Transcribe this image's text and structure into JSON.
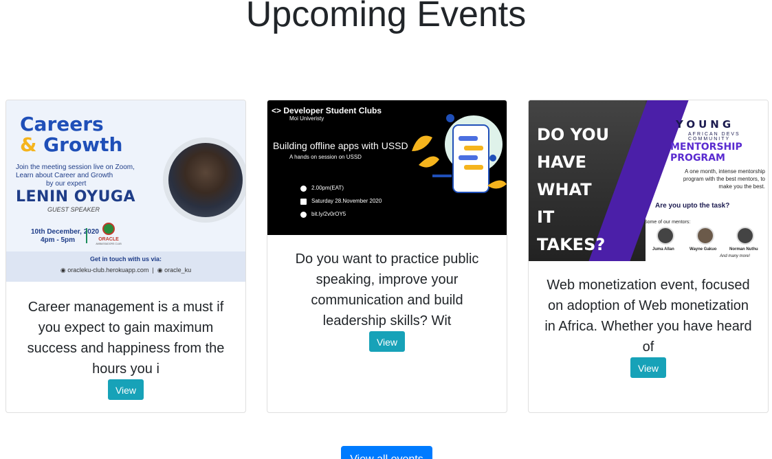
{
  "page": {
    "heading": "Upcoming Events",
    "view_all_label": "View all events"
  },
  "colors": {
    "view_button": "#17a2b8",
    "view_all_button": "#007bff"
  },
  "events": [
    {
      "description": "Career management is a must if you expect to gain maximum success and happiness from the hours you i",
      "button_label": "View",
      "poster": {
        "title_line1": "Careers",
        "title_amp": "&",
        "title_line2": "Growth",
        "sub1": "Join the meeting session live on Zoom,",
        "sub2": "Learn about Career and Growth",
        "sub3": "by our expert",
        "speaker": "LENIN OYUGA",
        "role": "GUEST SPEAKER",
        "date": "10th December, 2020",
        "time": "4pm - 5pm",
        "club": "ORACLE",
        "club_sub": "AMBASSADORS CLUB",
        "contact_heading": "Get in touch with us via:",
        "contact_site": "oracleku-club.herokuapp.com",
        "contact_handle": "oracle_ku"
      }
    },
    {
      "description": "Do you want to practice public speaking, improve your communication and build leadership skills? Wit",
      "button_label": "View",
      "poster": {
        "logo": "<> Developer Student Clubs",
        "university": "Moi Univeristy",
        "title": "Building offline apps with USSD",
        "subtitle": "A hands on session on USSD",
        "time": "2.00pm(EAT)",
        "date": "Saturday 28.November 2020",
        "link": "bit.ly/2v0rOY5"
      }
    },
    {
      "description": "Web monetization event, focused on adoption of Web monetization in Africa. Whether you have heard of",
      "button_label": "View",
      "poster": {
        "headline": [
          "DO YOU",
          "HAVE",
          "WHAT",
          "IT",
          "TAKES?"
        ],
        "org_line1": "YOUNG",
        "org_line2": "AFRICAN DEVS COMMUNITY",
        "program": "MENTORSHIP PROGRAM",
        "description": "A one month, intense mentorship program with the best mentors, to make you the best.",
        "question": "Are you upto the task?",
        "mentors_heading": "Some of our mentors:",
        "mentors": [
          "Juma Allan",
          "Wayne Gakuo",
          "Norman Nuthu"
        ],
        "more": "And many more!"
      }
    }
  ]
}
